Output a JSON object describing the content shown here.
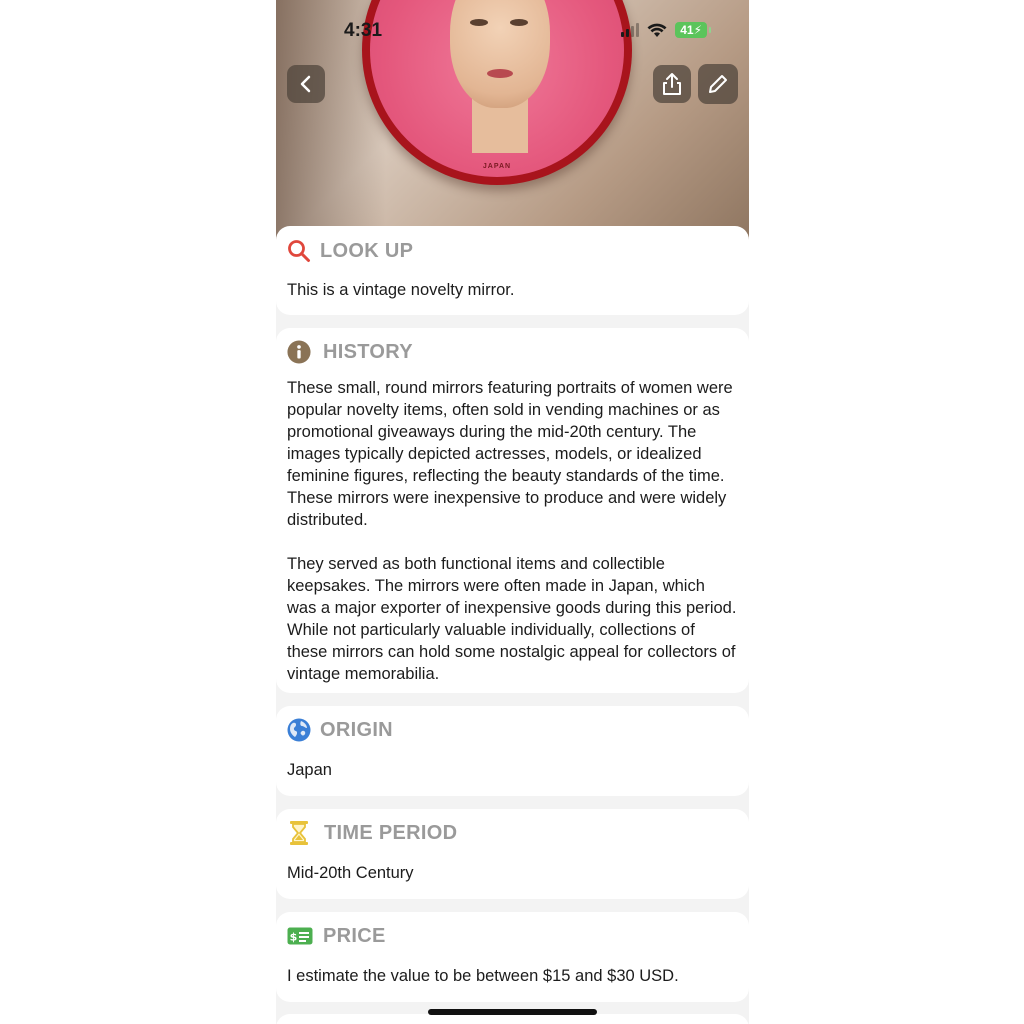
{
  "status_bar": {
    "time": "4:31",
    "battery": "41"
  },
  "hero": {
    "mirror_text": "JAPAN"
  },
  "sections": {
    "lookup": {
      "title": "LOOK UP",
      "body": "This is a vintage novelty mirror."
    },
    "history": {
      "title": "HISTORY",
      "paragraph1": "These small, round mirrors featuring portraits of women were popular novelty items, often sold in vending machines or as promotional giveaways during the mid-20th century. The images typically depicted actresses, models, or idealized feminine figures, reflecting the beauty standards of the time. These mirrors were inexpensive to produce and were widely distributed.",
      "paragraph2": "They served as both functional items and collectible keepsakes. The mirrors were often made in Japan, which was a major exporter of inexpensive goods during this period. While not particularly valuable individually, collections of these mirrors can hold some nostalgic appeal for collectors of vintage memorabilia."
    },
    "origin": {
      "title": "ORIGIN",
      "body": "Japan"
    },
    "time_period": {
      "title": "TIME PERIOD",
      "body": "Mid-20th Century"
    },
    "price": {
      "title": "PRICE",
      "body": "I estimate the value to be between $15 and $30 USD."
    }
  },
  "icons": {
    "lookup": "search-icon",
    "history": "info-icon",
    "origin": "globe-icon",
    "time_period": "hourglass-icon",
    "price": "money-icon",
    "back": "chevron-left-icon",
    "share": "share-icon",
    "edit": "pencil-icon"
  },
  "colors": {
    "lookup_icon": "#e0473c",
    "history_icon": "#8a7356",
    "origin_icon": "#3b7fd6",
    "time_icon": "#e8c23a",
    "price_icon": "#4caf50",
    "title_text": "#9a9a9a"
  }
}
